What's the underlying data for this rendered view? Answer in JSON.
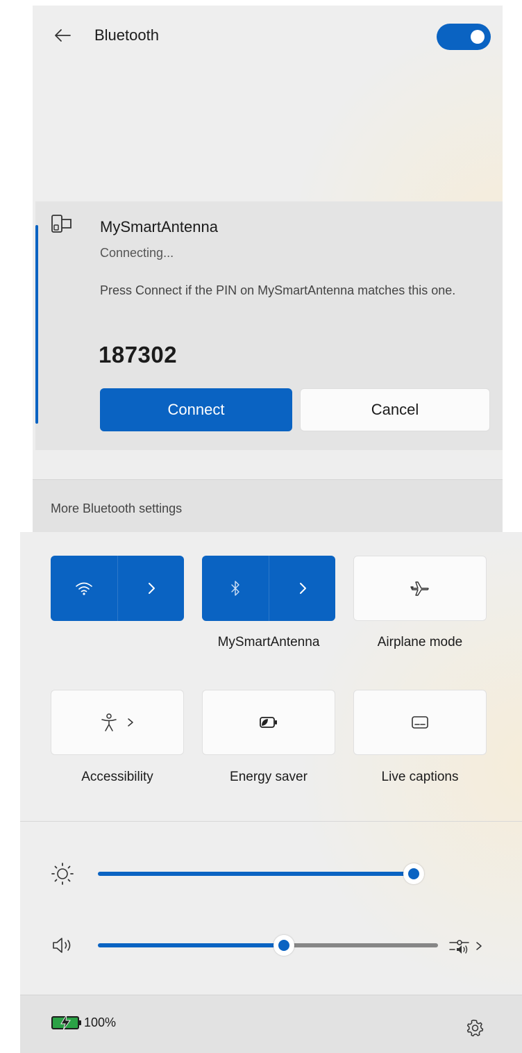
{
  "bluetooth_panel": {
    "title": "Bluetooth",
    "toggle_on": true,
    "device": {
      "name": "MySmartAntenna",
      "status": "Connecting...",
      "message": "Press Connect if the PIN on MySmartAntenna matches this one.",
      "pin": "187302"
    },
    "connect_label": "Connect",
    "cancel_label": "Cancel",
    "more_settings_label": "More Bluetooth settings"
  },
  "quick_settings": {
    "tiles": [
      {
        "id": "wifi",
        "label": "",
        "active": true,
        "icon": "wifi-icon"
      },
      {
        "id": "bluetooth",
        "label": "MySmartAntenna",
        "active": true,
        "icon": "bluetooth-icon"
      },
      {
        "id": "airplane",
        "label": "Airplane mode",
        "active": false,
        "icon": "airplane-icon"
      },
      {
        "id": "accessibility",
        "label": "Accessibility",
        "active": false,
        "icon": "accessibility-icon"
      },
      {
        "id": "energy",
        "label": "Energy saver",
        "active": false,
        "icon": "energy-saver-icon"
      },
      {
        "id": "captions",
        "label": "Live captions",
        "active": false,
        "icon": "live-captions-icon"
      }
    ],
    "brightness_percent": 100,
    "volume_percent": 55,
    "battery_text": "100%"
  },
  "colors": {
    "accent": "#0a63c2",
    "panel_background": "#eeeeee",
    "tile_off": "#fbfbfb"
  }
}
